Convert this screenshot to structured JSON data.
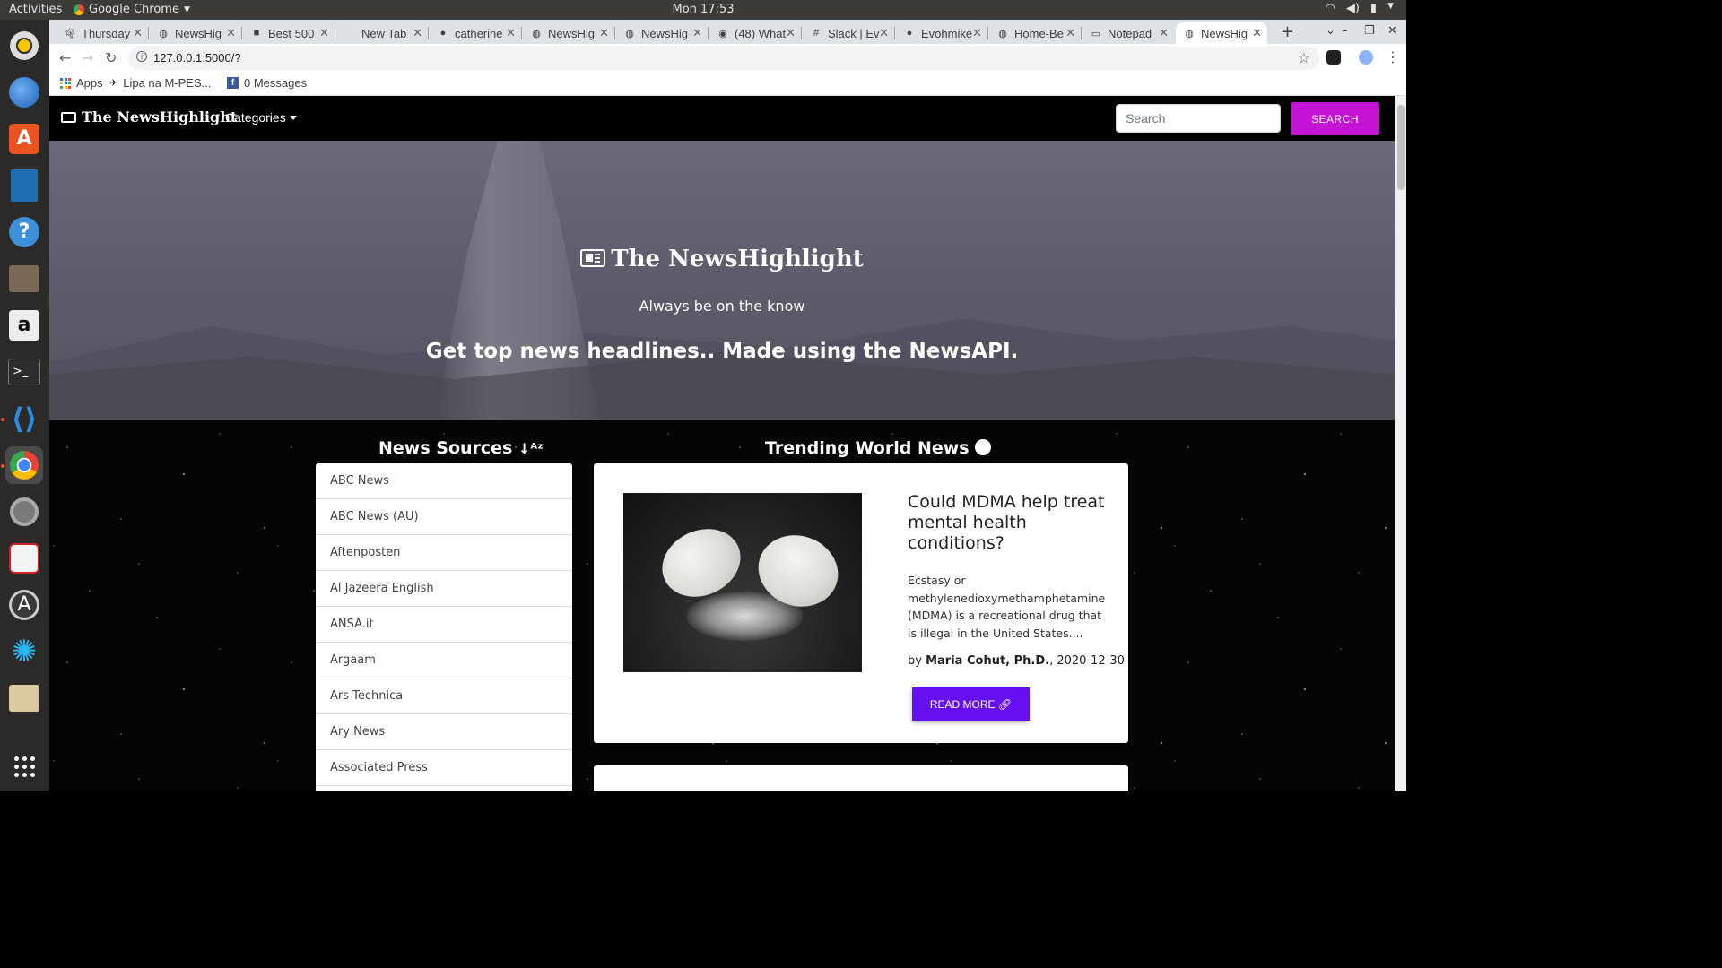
{
  "topbar": {
    "activities": "Activities",
    "app_name": "Google Chrome",
    "clock": "Mon 17:53"
  },
  "tabs": [
    {
      "title": "Thursday",
      "icon": "palm-icon"
    },
    {
      "title": "NewsHig",
      "icon": "globe-icon"
    },
    {
      "title": "Best 500",
      "icon": "briefcase-icon"
    },
    {
      "title": "New Tab",
      "icon": ""
    },
    {
      "title": "catherine",
      "icon": "github-icon"
    },
    {
      "title": "NewsHig",
      "icon": "globe-icon"
    },
    {
      "title": "NewsHig",
      "icon": "globe-icon"
    },
    {
      "title": "(48) What",
      "icon": "whatsapp-icon"
    },
    {
      "title": "Slack | Ev",
      "icon": "slack-icon"
    },
    {
      "title": "Evohmike",
      "icon": "github-icon"
    },
    {
      "title": "Home-Be",
      "icon": "globe-icon"
    },
    {
      "title": "Notepad",
      "icon": "notepad-icon"
    },
    {
      "title": "NewsHig",
      "icon": "globe-icon"
    }
  ],
  "omnibox": {
    "url": "127.0.0.1:5000/?"
  },
  "bookmarks": [
    {
      "label": "Apps"
    },
    {
      "label": "Lipa na M-PES..."
    },
    {
      "label": "0 Messages"
    }
  ],
  "navbar": {
    "brand": "The NewsHighlight",
    "categories": "Categories",
    "search_placeholder": "Search",
    "search_button": "SEARCH"
  },
  "hero": {
    "title": "The NewsHighlight",
    "tagline": "Always be on the know",
    "subtitle": "Get top news headlines.. Made using the NewsAPI."
  },
  "sources": {
    "heading": "News Sources",
    "items": [
      "ABC News",
      "ABC News (AU)",
      "Aftenposten",
      "Al Jazeera English",
      "ANSA.it",
      "Argaam",
      "Ars Technica",
      "Ary News",
      "Associated Press"
    ]
  },
  "trending": {
    "heading": "Trending World News",
    "article": {
      "title": "Could MDMA help treat mental health conditions?",
      "description": "Ecstasy or methylenedioxymethamphetamine (MDMA) is a recreational drug that is illegal in the United States....",
      "by": "by",
      "author": "Maria Cohut, Ph.D.",
      "date": ", 2020-12-30",
      "read_more": "READ MORE"
    }
  },
  "colors": {
    "search_button": "#c513d6",
    "read_more": "#6610f2",
    "navbar": "#000000"
  }
}
